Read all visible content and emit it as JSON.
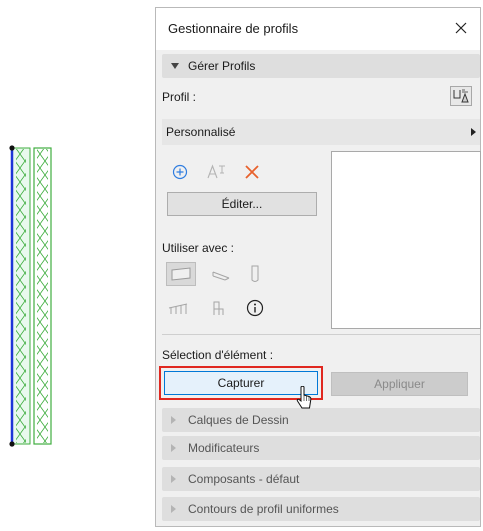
{
  "window": {
    "title": "Gestionnaire de profils"
  },
  "sections": {
    "manage": {
      "label": "Gérer Profils"
    },
    "collapsed": [
      {
        "label": "Calques de Dessin"
      },
      {
        "label": "Modificateurs"
      },
      {
        "label": "Composants - défaut"
      },
      {
        "label": "Contours de profil uniformes"
      }
    ]
  },
  "profile": {
    "label": "Profil :",
    "value": "Personnalisé"
  },
  "buttons": {
    "edit": "Éditer...",
    "capture": "Capturer",
    "apply": "Appliquer"
  },
  "use_with": {
    "label": "Utiliser avec :"
  },
  "selection": {
    "label": "Sélection d'élément :"
  },
  "icons": {
    "close": "close-icon",
    "profile_manager": "profile-manager-icon",
    "new": "new-profile-icon",
    "rename": "rename-icon",
    "delete": "delete-icon",
    "wall": "wall-icon",
    "beam": "beam-icon",
    "column": "column-icon",
    "railing": "railing-icon",
    "object": "object-icon",
    "info": "info-icon",
    "cursor": "cursor-icon"
  },
  "colors": {
    "highlight": "#e0271f",
    "capture_bg": "#e5f1fb",
    "capture_border": "#0078d7",
    "delete": "#e8612c",
    "new": "#2f7de0",
    "wall_blue": "#1f35d8",
    "wall_green": "#3fae3f"
  }
}
